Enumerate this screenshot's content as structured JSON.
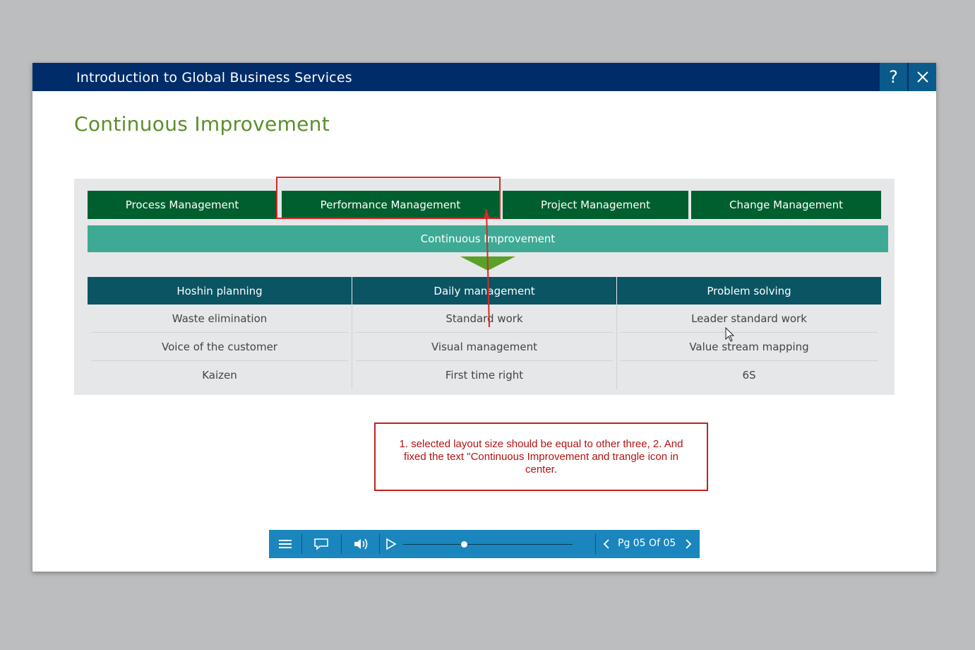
{
  "window": {
    "title": "Introduction to Global Business Services",
    "help_icon": "question-icon",
    "close_icon": "close-icon"
  },
  "slide": {
    "title": "Continuous Improvement",
    "categories": [
      {
        "label": "Process Management"
      },
      {
        "label": "Performance Management"
      },
      {
        "label": "Project Management"
      },
      {
        "label": "Change Management"
      }
    ],
    "banner": "Continuous Improvement",
    "columns": [
      {
        "header": "Hoshin planning",
        "items": [
          "Waste elimination",
          "Voice of the customer",
          "Kaizen"
        ]
      },
      {
        "header": "Daily management",
        "items": [
          "Standard work",
          "Visual management",
          "First time right"
        ]
      },
      {
        "header": "Problem solving",
        "items": [
          "Leader standard work",
          "Value stream mapping",
          "6S"
        ]
      }
    ]
  },
  "annotation": {
    "note": "1. selected layout size should be equal to other three, 2. And fixed the text \"Continuous Improvement and trangle icon in center."
  },
  "player": {
    "menu_icon": "menu-icon",
    "transcript_icon": "speech-bubble-icon",
    "volume_icon": "volume-icon",
    "play_icon": "play-icon",
    "progress": 0.36,
    "page_label": "Pg 05 Of 05"
  },
  "colors": {
    "titlebar": "#002d6a",
    "slide_title": "#5b8f2a",
    "category": "#005f2e",
    "banner": "#3eaa95",
    "column_header": "#0a5463",
    "player": "#1a86bd",
    "annotation": "#c32020"
  }
}
